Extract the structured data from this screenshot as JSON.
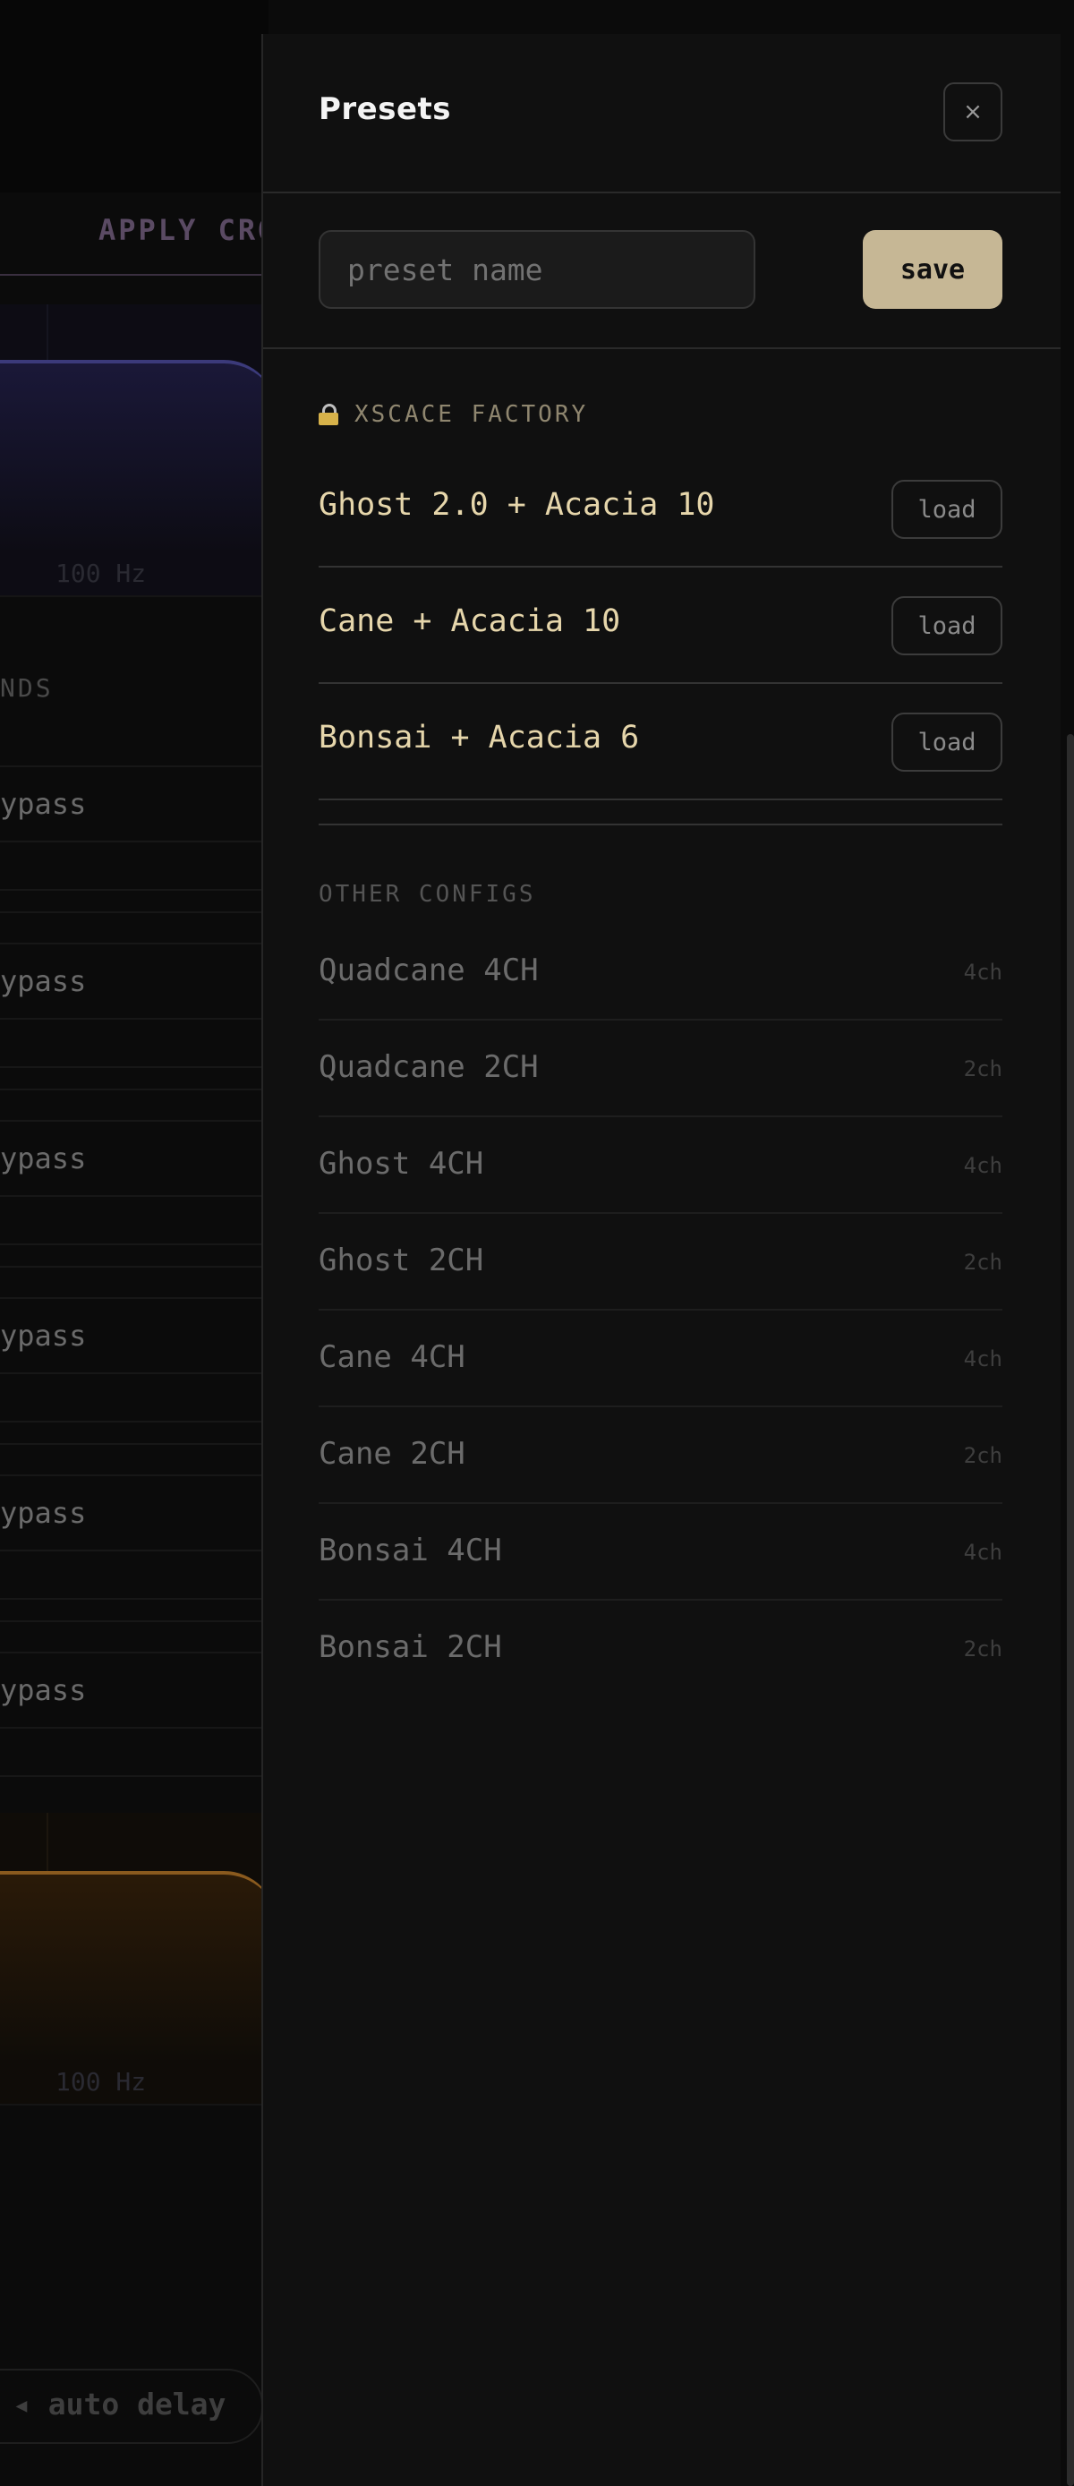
{
  "background": {
    "tab_label": "APPLY CRO",
    "graph_freq_label": "100 Hz",
    "bands_label": "NDS",
    "bypass_rows": [
      "ypass",
      "ypass",
      "ypass",
      "ypass",
      "ypass",
      "ypass"
    ],
    "auto_delay_label": "◂ auto delay"
  },
  "presets_panel": {
    "title": "Presets",
    "close_icon_glyph": "×",
    "preset_name_placeholder": "preset name",
    "save_label": "save",
    "factory_section": {
      "label": "XSCACE FACTORY",
      "items": [
        {
          "name": "Ghost 2.0 + Acacia 10",
          "action": "load"
        },
        {
          "name": "Cane + Acacia 10",
          "action": "load"
        },
        {
          "name": "Bonsai + Acacia 6",
          "action": "load"
        }
      ]
    },
    "other_section": {
      "label": "OTHER CONFIGS",
      "items": [
        {
          "name": "Quadcane 4CH",
          "channels": "4ch"
        },
        {
          "name": "Quadcane 2CH",
          "channels": "2ch"
        },
        {
          "name": "Ghost 4CH",
          "channels": "4ch"
        },
        {
          "name": "Ghost 2CH",
          "channels": "2ch"
        },
        {
          "name": "Cane 4CH",
          "channels": "4ch"
        },
        {
          "name": "Cane 2CH",
          "channels": "2ch"
        },
        {
          "name": "Bonsai 4CH",
          "channels": "4ch"
        },
        {
          "name": "Bonsai 2CH",
          "channels": "2ch"
        }
      ]
    }
  },
  "colors": {
    "accent_gold": "#c6b795",
    "factory_name": "#e6d6ab",
    "panel_bg": "#101010"
  }
}
